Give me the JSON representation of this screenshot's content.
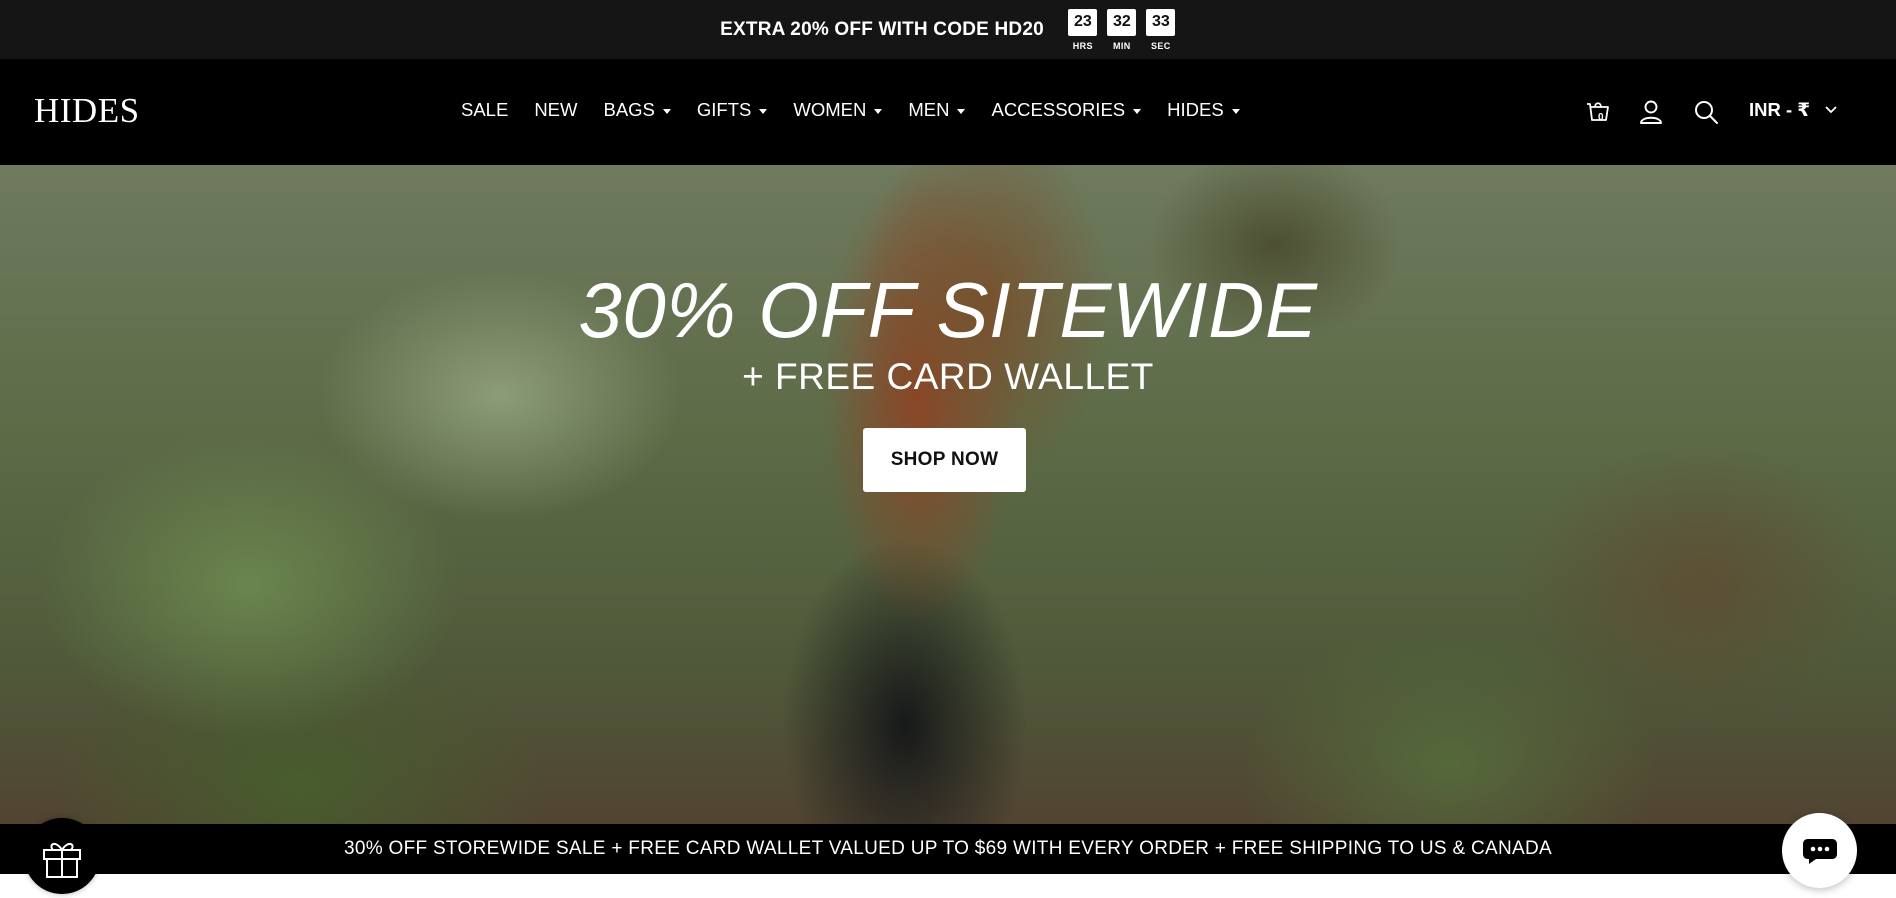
{
  "announcement": {
    "text": "EXTRA 20% OFF WITH CODE HD20",
    "countdown": [
      {
        "value": "23",
        "label": "HRS"
      },
      {
        "value": "32",
        "label": "MIN"
      },
      {
        "value": "33",
        "label": "SEC"
      }
    ]
  },
  "header": {
    "logo": "HIDES",
    "nav": [
      {
        "label": "SALE",
        "dropdown": false
      },
      {
        "label": "NEW",
        "dropdown": false
      },
      {
        "label": "BAGS",
        "dropdown": true
      },
      {
        "label": "GIFTS",
        "dropdown": true
      },
      {
        "label": "WOMEN",
        "dropdown": true
      },
      {
        "label": "MEN",
        "dropdown": true
      },
      {
        "label": "ACCESSORIES",
        "dropdown": true
      },
      {
        "label": "HIDES",
        "dropdown": true
      }
    ],
    "cart_count": "0",
    "currency": "INR - ₹",
    "icons": [
      "cart-icon",
      "account-icon",
      "search-icon",
      "chevron-down-icon"
    ]
  },
  "hero": {
    "headline": "30% OFF SITEWIDE",
    "subheadline": "+ FREE CARD WALLET",
    "cta_label": "SHOP NOW"
  },
  "promo_bar": {
    "text": "30% OFF STOREWIDE SALE + FREE CARD WALLET VALUED UP TO $69 WITH EVERY ORDER + FREE SHIPPING TO US & CANADA"
  },
  "widgets": {
    "gift": "gift-icon",
    "chat": "chat-icon"
  },
  "colors": {
    "announcement_bg": "#151515",
    "header_bg": "#000000",
    "promo_bg": "#000000",
    "text_light": "#ffffff"
  }
}
